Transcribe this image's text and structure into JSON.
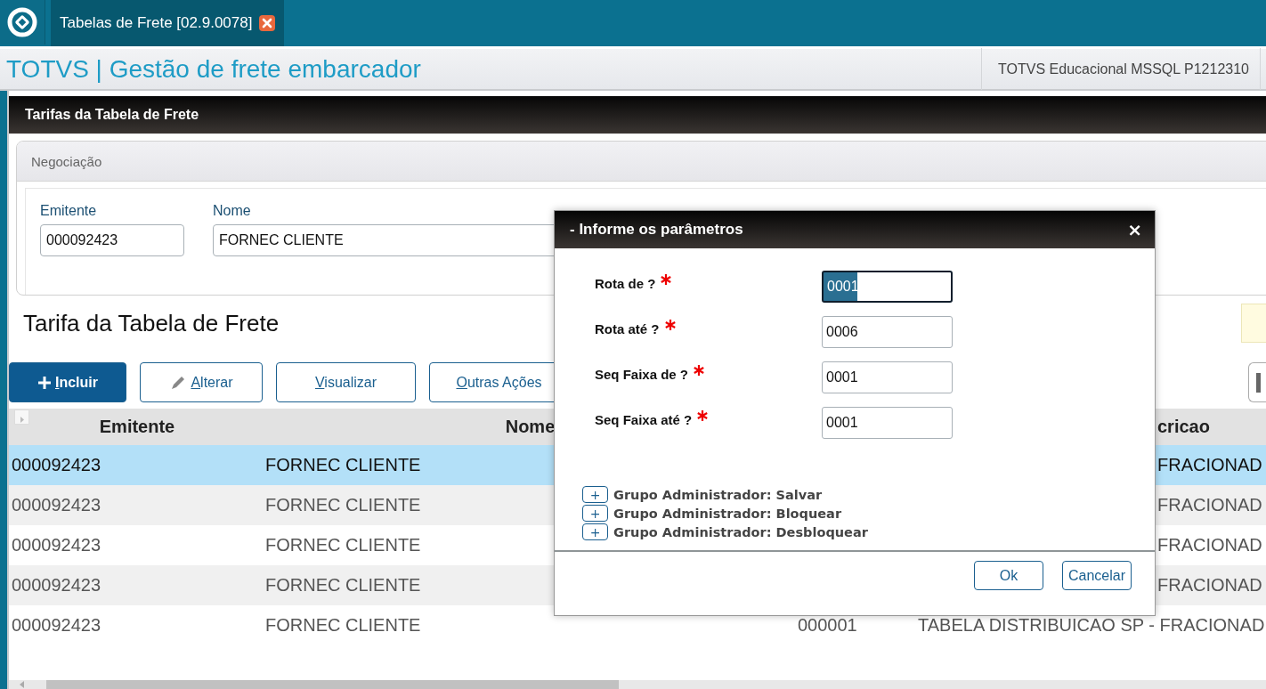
{
  "app_tabs": [
    {
      "label": "Tabelas de Frete [02.9.0078]",
      "selected": true
    }
  ],
  "header": {
    "title": "TOTVS | Gestão de frete embarcador",
    "environment": "TOTVS Educacional MSSQL P1212310"
  },
  "page_title": "Tarifas da Tabela de Frete",
  "negotiation_panel": {
    "title": "Negociação",
    "fields": [
      {
        "label": "Emitente",
        "value": "000092423"
      },
      {
        "label": "Nome",
        "value": "FORNEC CLIENTE"
      }
    ]
  },
  "section_title": "Tarifa da Tabela de Frete",
  "actions": [
    {
      "label": "Incluir",
      "kind": "primary"
    },
    {
      "label": "Alterar",
      "kind": "edit"
    },
    {
      "label": "Visualizar",
      "kind": "plain"
    },
    {
      "label": "Outras Ações",
      "kind": "plain"
    }
  ],
  "table": {
    "columns": [
      "Emitente",
      "Nome",
      "cricao"
    ],
    "rows": [
      {
        "selected": true,
        "emitente": "000092423",
        "nome": "FORNEC CLIENTE",
        "descricao": "FRACIONAD"
      },
      {
        "selected": false,
        "emitente": "000092423",
        "nome": "FORNEC CLIENTE",
        "descricao": "FRACIONAD"
      },
      {
        "selected": false,
        "emitente": "000092423",
        "nome": "FORNEC CLIENTE",
        "descricao": "FRACIONAD"
      },
      {
        "selected": false,
        "emitente": "000092423",
        "nome": "FORNEC CLIENTE",
        "descricao": "FRACIONAD"
      },
      {
        "selected": false,
        "emitente": "000092423",
        "nome": "FORNEC CLIENTE",
        "column_3": "000001",
        "descricao": "TABELA DISTRIBUICAO SP - FRACIONAD"
      }
    ]
  },
  "dialog": {
    "title": "- Informe os parâmetros",
    "close": "×",
    "parameters": [
      {
        "label": "Rota de ?",
        "value": "0001",
        "required": true,
        "focused": true
      },
      {
        "label": "Rota até ?",
        "value": "0006",
        "required": true,
        "focused": false
      },
      {
        "label": "Seq Faixa de ?",
        "value": "0001",
        "required": true,
        "focused": false
      },
      {
        "label": "Seq Faixa até ?",
        "value": "0001",
        "required": true,
        "focused": false
      }
    ],
    "groups": [
      {
        "expander": "+",
        "label": "Grupo Administrador: Salvar"
      },
      {
        "expander": "+",
        "label": "Grupo Administrador: Bloquear"
      },
      {
        "expander": "+",
        "label": "Grupo Administrador: Desbloquear"
      }
    ],
    "buttons": [
      "Ok",
      "Cancelar"
    ]
  }
}
